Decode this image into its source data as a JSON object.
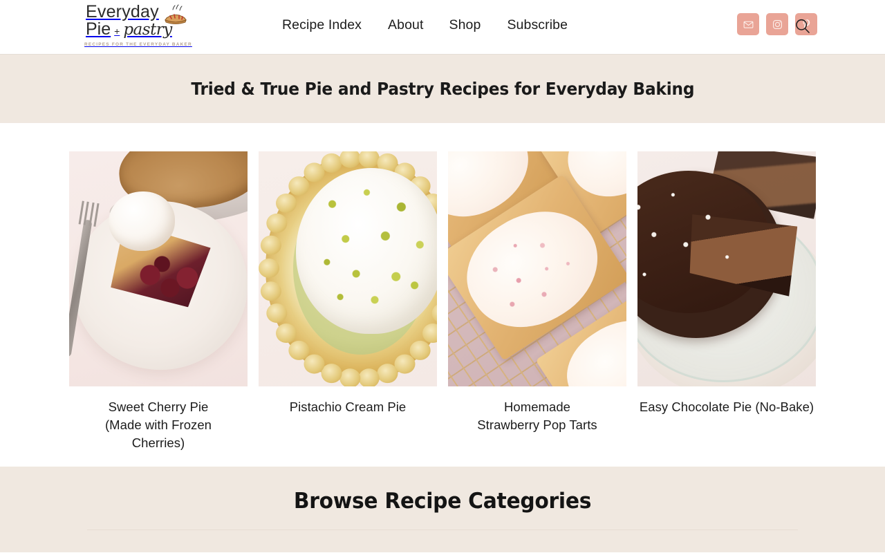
{
  "header": {
    "logo": {
      "line1": "Everyday",
      "line2_main": "Pie",
      "line2_plus": "+",
      "line2_script": "pastry",
      "tagline": "RECIPES FOR THE EVERYDAY BAKER",
      "icon": "pie-icon"
    },
    "nav": [
      {
        "label": "Recipe Index",
        "name": "nav-recipe-index"
      },
      {
        "label": "About",
        "name": "nav-about"
      },
      {
        "label": "Shop",
        "name": "nav-about"
      },
      {
        "label": "Subscribe",
        "name": "nav-subscribe"
      }
    ],
    "social": [
      {
        "label": "Email",
        "icon": "envelope-icon"
      },
      {
        "label": "Instagram",
        "icon": "instagram-icon"
      },
      {
        "label": "Pinterest",
        "icon": "pinterest-icon"
      }
    ],
    "search": {
      "label": "Search",
      "icon": "search-icon"
    }
  },
  "hero": {
    "title": "Tried & True Pie and Pastry Recipes for Everyday Baking"
  },
  "recipes": [
    {
      "title": "Sweet Cherry Pie (Made with Frozen Cherries)",
      "image_alt": "cherry-pie-slice-with-ice-cream"
    },
    {
      "title": "Pistachio Cream Pie",
      "image_alt": "pistachio-cream-pie"
    },
    {
      "title": "Homemade Strawberry Pop Tarts",
      "image_alt": "strawberry-pop-tarts"
    },
    {
      "title": "Easy Chocolate Pie (No-Bake)",
      "image_alt": "no-bake-chocolate-pie"
    }
  ],
  "categories": {
    "title": "Browse Recipe Categories"
  },
  "colors": {
    "accent_salmon": "#e9a496",
    "band_beige": "#f0e8e0",
    "text_dark": "#1a1a1a",
    "tagline_tan": "#b29f8d",
    "rule": "#e6dcd2"
  }
}
